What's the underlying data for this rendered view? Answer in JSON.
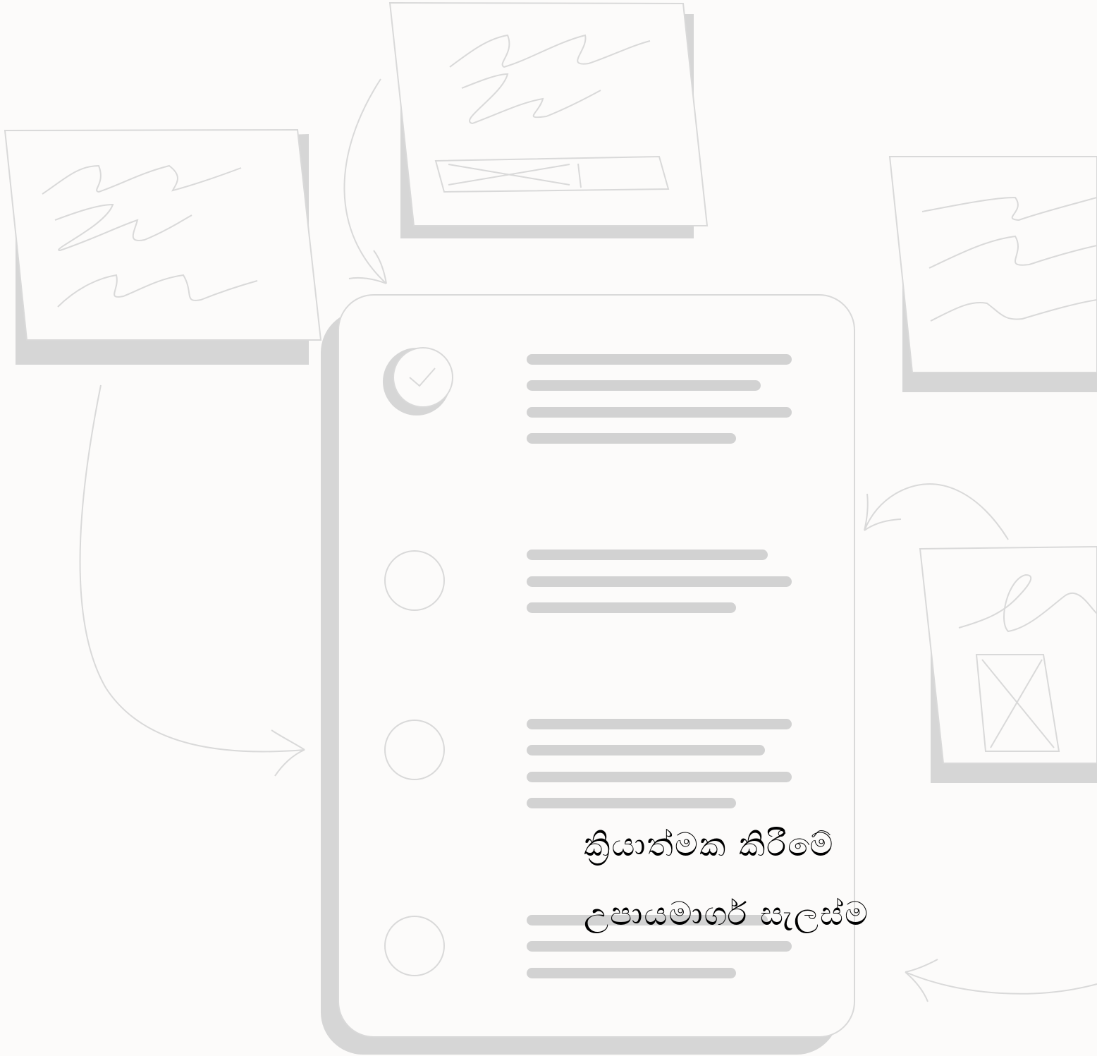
{
  "caption": {
    "line1": "ක්‍රියාත්මක කිරීමේ",
    "line2": "උපායමාර්ග සැලස්ම"
  },
  "checklist": {
    "items": [
      {
        "state": "checked",
        "lines": 4
      },
      {
        "state": "unchecked",
        "lines": 3
      },
      {
        "state": "unchecked",
        "lines": 4
      },
      {
        "state": "unchecked",
        "lines": 3
      }
    ]
  },
  "icons": {
    "check": "check-circle-icon",
    "circle": "empty-circle-icon",
    "arrow": "curved-arrow-icon",
    "note": "sticky-note-icon"
  },
  "colors": {
    "background": "#fcfbfa",
    "line": "#d9d9d9",
    "shadow": "#d6d6d6",
    "placeholder": "#d2d2d2",
    "text": "#000000"
  }
}
